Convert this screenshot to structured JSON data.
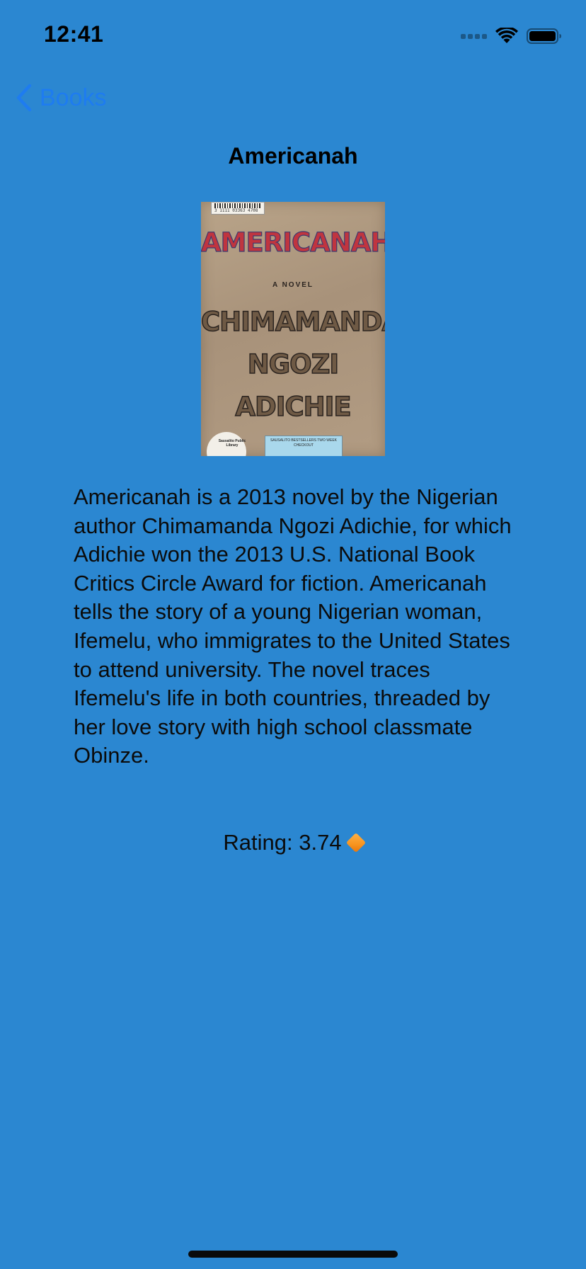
{
  "status_bar": {
    "time": "12:41"
  },
  "nav": {
    "back_label": "Books"
  },
  "page": {
    "title": "Americanah"
  },
  "cover": {
    "barcode_number": "3 1111 03363 4708",
    "title": "AMERICANAH",
    "subtitle": "A NOVEL",
    "author_line1": "CHIMAMANDA",
    "author_line2": "NGOZI",
    "author_line3": "ADICHIE",
    "seal_text": "Sausalito Public Library",
    "sticker_text": "SAUSALITO BESTSELLERS TWO WEEK CHECKOUT"
  },
  "book": {
    "description": "Americanah is a 2013 novel by the Nigerian author Chimamanda Ngozi Adichie, for which Adichie won the 2013 U.S. National Book Critics Circle Award for fiction. Americanah tells the story of a young Nigerian woman, Ifemelu, who immigrates to the United States to attend university. The novel traces Ifemelu's life in both countries, threaded by her love story with high school classmate Obinze.",
    "rating_text": "Rating: 3.74"
  },
  "colors": {
    "background": "#2B87D1",
    "accent": "#1E7CF0",
    "rating_icon": "#F7931E"
  },
  "icons": {
    "back": "chevron-left-icon",
    "rating": "orange-diamond-icon"
  }
}
